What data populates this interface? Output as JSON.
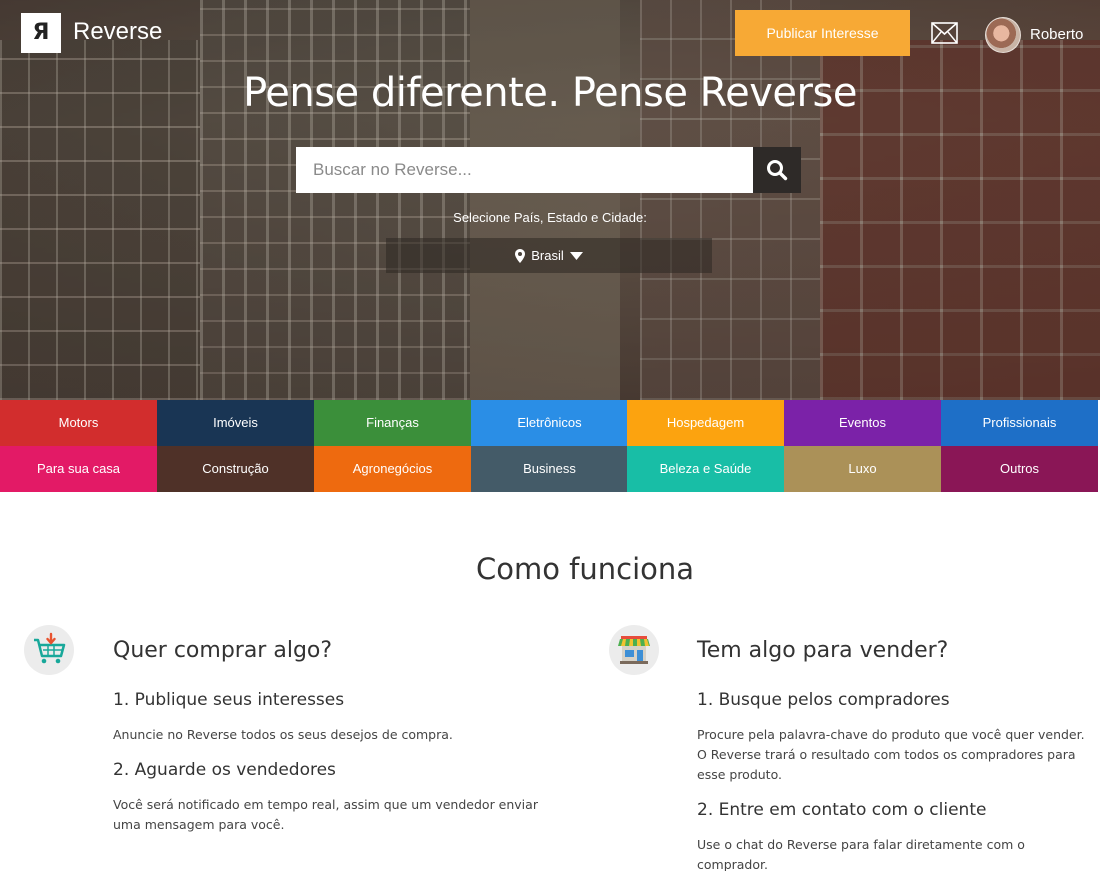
{
  "header": {
    "logo_mark": "Я",
    "logo_text": "Reverse",
    "publish_label": "Publicar Interesse",
    "user_name": "Roberto"
  },
  "hero": {
    "title": "Pense diferente. Pense Reverse",
    "search_placeholder": "Buscar no Reverse...",
    "select_label": "Selecione País, Estado e Cidade:",
    "location_value": "Brasil"
  },
  "categories": [
    {
      "label": "Motors",
      "color": "#d22d2d"
    },
    {
      "label": "Imóveis",
      "color": "#193554"
    },
    {
      "label": "Finanças",
      "color": "#3b8f3a"
    },
    {
      "label": "Eletrônicos",
      "color": "#2a8ee6"
    },
    {
      "label": "Hospedagem",
      "color": "#fca30f"
    },
    {
      "label": "Eventos",
      "color": "#7b22a8"
    },
    {
      "label": "Profissionais",
      "color": "#1e6fc7"
    },
    {
      "label": "Para sua casa",
      "color": "#e31a66"
    },
    {
      "label": "Construção",
      "color": "#4f3128"
    },
    {
      "label": "Agronegócios",
      "color": "#ee6a0f"
    },
    {
      "label": "Business",
      "color": "#445b68"
    },
    {
      "label": "Beleza e Saúde",
      "color": "#18bea6"
    },
    {
      "label": "Luxo",
      "color": "#ab9158"
    },
    {
      "label": "Outros",
      "color": "#8a1656"
    }
  ],
  "how_it_works": {
    "title": "Como funciona",
    "buy": {
      "title": "Quer comprar algo?",
      "steps": [
        {
          "title": "1. Publique seus interesses",
          "text": "Anuncie no Reverse todos os seus desejos de compra."
        },
        {
          "title": "2. Aguarde os vendedores",
          "text": "Você será notificado em tempo real, assim que um vendedor enviar uma mensagem para você."
        }
      ]
    },
    "sell": {
      "title": "Tem algo para vender?",
      "steps": [
        {
          "title": "1. Busque pelos compradores",
          "text": "Procure pela palavra-chave do produto que você quer vender. O Reverse trará o resultado com todos os compradores para esse produto."
        },
        {
          "title": "2. Entre em contato com o cliente",
          "text": "Use o chat do Reverse para falar diretamente com o comprador."
        }
      ]
    }
  }
}
